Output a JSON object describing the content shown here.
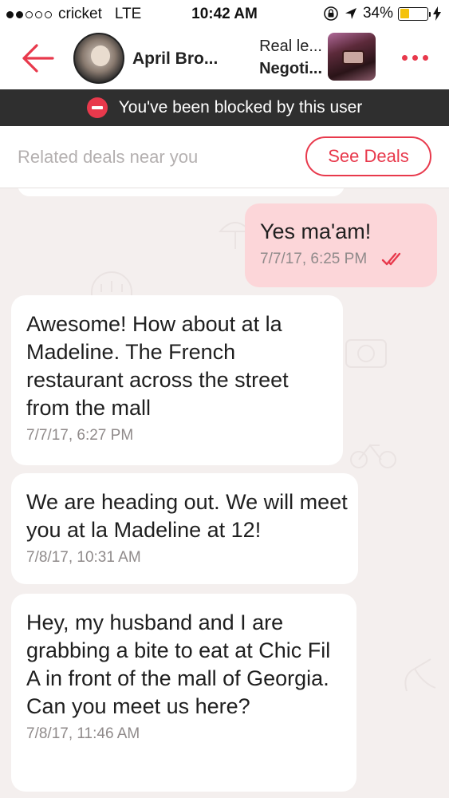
{
  "status_bar": {
    "carrier": "cricket",
    "network": "LTE",
    "time": "10:42 AM",
    "battery": "34%",
    "battery_level": 0.34
  },
  "header": {
    "user_name": "April Bro...",
    "item_title": "Real le...",
    "item_status": "Negoti..."
  },
  "blocked_banner": {
    "text": "You've been blocked by this user"
  },
  "deals_bar": {
    "label": "Related deals near you",
    "button_label": "See Deals"
  },
  "messages": [
    {
      "direction": "outgoing",
      "text": "Yes ma'am!",
      "time": "7/7/17, 6:25 PM",
      "read": true
    },
    {
      "direction": "incoming",
      "text": "Awesome! How about at la Madeline. The French restaurant across the street from the mall",
      "time": "7/7/17, 6:27 PM"
    },
    {
      "direction": "incoming",
      "text": "We are heading out. We will meet you at la Madeline at 12!",
      "time": "7/8/17, 10:31 AM"
    },
    {
      "direction": "incoming",
      "text": "Hey, my husband and I are grabbing a bite to eat at Chic Fil A in front of the mall of Georgia. Can you meet us here?",
      "time": "7/8/17, 11:46 AM"
    }
  ],
  "colors": {
    "accent": "#e8394c",
    "outgoing_bubble": "#fcd6d9",
    "banner": "#2f2f2f",
    "chat_background": "#f4efee"
  },
  "icons": [
    "signal-dots-icon",
    "lock-rotation-icon",
    "location-arrow-icon",
    "battery-icon",
    "charging-bolt-icon",
    "back-arrow-icon",
    "more-dots-icon",
    "blocked-icon",
    "double-check-icon"
  ]
}
